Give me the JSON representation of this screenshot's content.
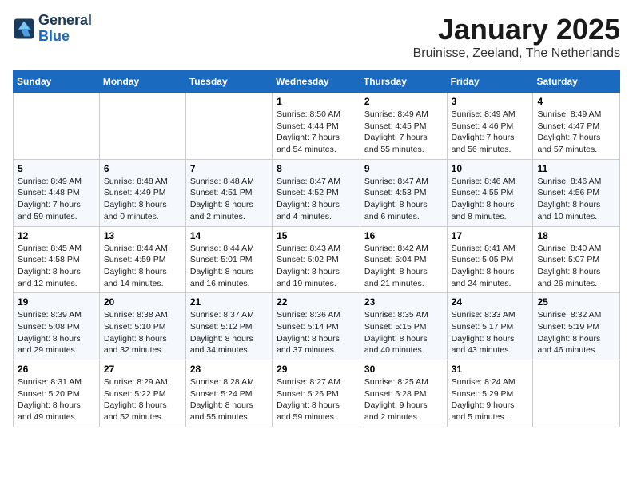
{
  "logo": {
    "line1": "General",
    "line2": "Blue"
  },
  "title": "January 2025",
  "location": "Bruinisse, Zeeland, The Netherlands",
  "weekdays": [
    "Sunday",
    "Monday",
    "Tuesday",
    "Wednesday",
    "Thursday",
    "Friday",
    "Saturday"
  ],
  "weeks": [
    [
      {
        "day": "",
        "info": ""
      },
      {
        "day": "",
        "info": ""
      },
      {
        "day": "",
        "info": ""
      },
      {
        "day": "1",
        "info": "Sunrise: 8:50 AM\nSunset: 4:44 PM\nDaylight: 7 hours\nand 54 minutes."
      },
      {
        "day": "2",
        "info": "Sunrise: 8:49 AM\nSunset: 4:45 PM\nDaylight: 7 hours\nand 55 minutes."
      },
      {
        "day": "3",
        "info": "Sunrise: 8:49 AM\nSunset: 4:46 PM\nDaylight: 7 hours\nand 56 minutes."
      },
      {
        "day": "4",
        "info": "Sunrise: 8:49 AM\nSunset: 4:47 PM\nDaylight: 7 hours\nand 57 minutes."
      }
    ],
    [
      {
        "day": "5",
        "info": "Sunrise: 8:49 AM\nSunset: 4:48 PM\nDaylight: 7 hours\nand 59 minutes."
      },
      {
        "day": "6",
        "info": "Sunrise: 8:48 AM\nSunset: 4:49 PM\nDaylight: 8 hours\nand 0 minutes."
      },
      {
        "day": "7",
        "info": "Sunrise: 8:48 AM\nSunset: 4:51 PM\nDaylight: 8 hours\nand 2 minutes."
      },
      {
        "day": "8",
        "info": "Sunrise: 8:47 AM\nSunset: 4:52 PM\nDaylight: 8 hours\nand 4 minutes."
      },
      {
        "day": "9",
        "info": "Sunrise: 8:47 AM\nSunset: 4:53 PM\nDaylight: 8 hours\nand 6 minutes."
      },
      {
        "day": "10",
        "info": "Sunrise: 8:46 AM\nSunset: 4:55 PM\nDaylight: 8 hours\nand 8 minutes."
      },
      {
        "day": "11",
        "info": "Sunrise: 8:46 AM\nSunset: 4:56 PM\nDaylight: 8 hours\nand 10 minutes."
      }
    ],
    [
      {
        "day": "12",
        "info": "Sunrise: 8:45 AM\nSunset: 4:58 PM\nDaylight: 8 hours\nand 12 minutes."
      },
      {
        "day": "13",
        "info": "Sunrise: 8:44 AM\nSunset: 4:59 PM\nDaylight: 8 hours\nand 14 minutes."
      },
      {
        "day": "14",
        "info": "Sunrise: 8:44 AM\nSunset: 5:01 PM\nDaylight: 8 hours\nand 16 minutes."
      },
      {
        "day": "15",
        "info": "Sunrise: 8:43 AM\nSunset: 5:02 PM\nDaylight: 8 hours\nand 19 minutes."
      },
      {
        "day": "16",
        "info": "Sunrise: 8:42 AM\nSunset: 5:04 PM\nDaylight: 8 hours\nand 21 minutes."
      },
      {
        "day": "17",
        "info": "Sunrise: 8:41 AM\nSunset: 5:05 PM\nDaylight: 8 hours\nand 24 minutes."
      },
      {
        "day": "18",
        "info": "Sunrise: 8:40 AM\nSunset: 5:07 PM\nDaylight: 8 hours\nand 26 minutes."
      }
    ],
    [
      {
        "day": "19",
        "info": "Sunrise: 8:39 AM\nSunset: 5:08 PM\nDaylight: 8 hours\nand 29 minutes."
      },
      {
        "day": "20",
        "info": "Sunrise: 8:38 AM\nSunset: 5:10 PM\nDaylight: 8 hours\nand 32 minutes."
      },
      {
        "day": "21",
        "info": "Sunrise: 8:37 AM\nSunset: 5:12 PM\nDaylight: 8 hours\nand 34 minutes."
      },
      {
        "day": "22",
        "info": "Sunrise: 8:36 AM\nSunset: 5:14 PM\nDaylight: 8 hours\nand 37 minutes."
      },
      {
        "day": "23",
        "info": "Sunrise: 8:35 AM\nSunset: 5:15 PM\nDaylight: 8 hours\nand 40 minutes."
      },
      {
        "day": "24",
        "info": "Sunrise: 8:33 AM\nSunset: 5:17 PM\nDaylight: 8 hours\nand 43 minutes."
      },
      {
        "day": "25",
        "info": "Sunrise: 8:32 AM\nSunset: 5:19 PM\nDaylight: 8 hours\nand 46 minutes."
      }
    ],
    [
      {
        "day": "26",
        "info": "Sunrise: 8:31 AM\nSunset: 5:20 PM\nDaylight: 8 hours\nand 49 minutes."
      },
      {
        "day": "27",
        "info": "Sunrise: 8:29 AM\nSunset: 5:22 PM\nDaylight: 8 hours\nand 52 minutes."
      },
      {
        "day": "28",
        "info": "Sunrise: 8:28 AM\nSunset: 5:24 PM\nDaylight: 8 hours\nand 55 minutes."
      },
      {
        "day": "29",
        "info": "Sunrise: 8:27 AM\nSunset: 5:26 PM\nDaylight: 8 hours\nand 59 minutes."
      },
      {
        "day": "30",
        "info": "Sunrise: 8:25 AM\nSunset: 5:28 PM\nDaylight: 9 hours\nand 2 minutes."
      },
      {
        "day": "31",
        "info": "Sunrise: 8:24 AM\nSunset: 5:29 PM\nDaylight: 9 hours\nand 5 minutes."
      },
      {
        "day": "",
        "info": ""
      }
    ]
  ]
}
